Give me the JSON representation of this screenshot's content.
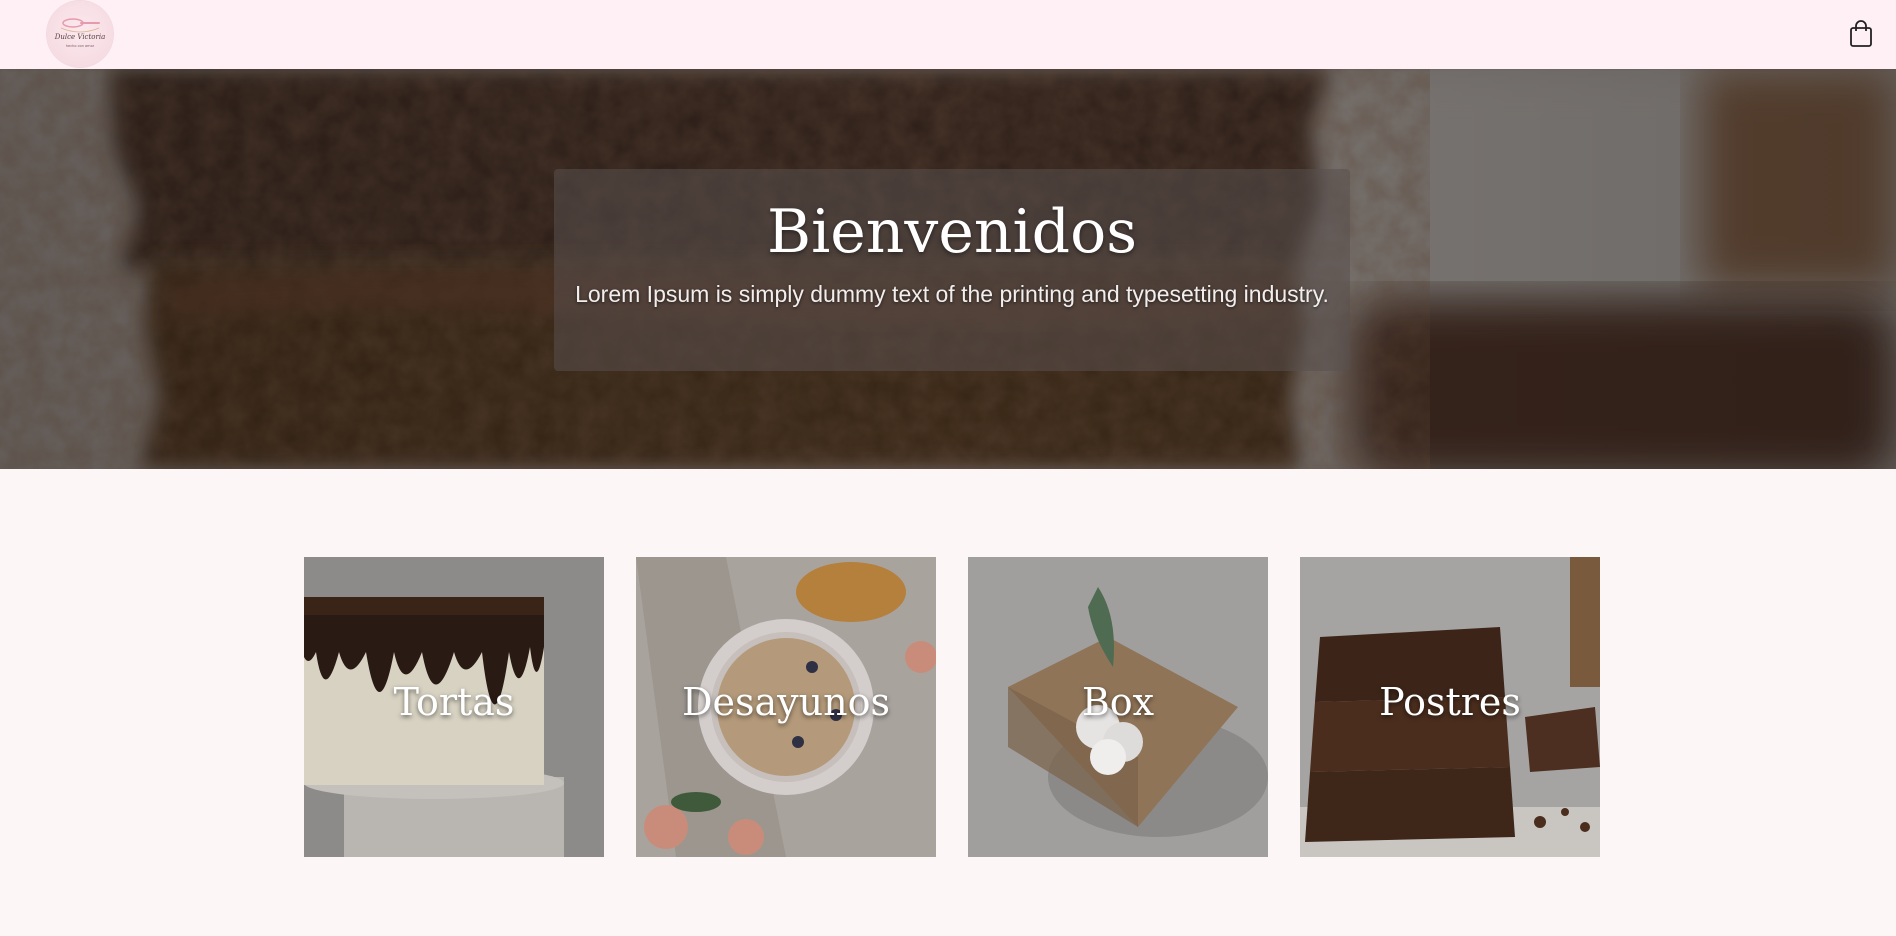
{
  "brand": {
    "logo_text": "Dulce Victoria",
    "logo_tagline": "hecho con amor"
  },
  "icons": {
    "cart": "shopping-bag-icon"
  },
  "hero": {
    "title": "Bienvenidos",
    "subtitle": "Lorem Ipsum is simply dummy text of the printing and typesetting industry."
  },
  "categories": [
    {
      "label": "Tortas"
    },
    {
      "label": "Desayunos"
    },
    {
      "label": "Box"
    },
    {
      "label": "Postres"
    }
  ],
  "colors": {
    "navbar_bg": "#fff0f5",
    "page_bg": "#fdf6f6",
    "text_light": "#ffffff"
  }
}
